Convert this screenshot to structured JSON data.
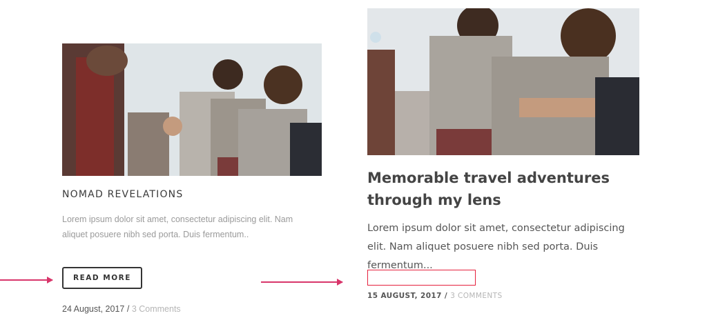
{
  "cards": [
    {
      "title": "NOMAD REVELATIONS",
      "excerpt": "Lorem ipsum dolor sit amet, consectetur adipiscing elit. Nam aliquet posuere nibh sed porta. Duis fermentum..",
      "button_label": "READ MORE",
      "date": "24 August, 2017",
      "separator": "/",
      "comments": "3 Comments"
    },
    {
      "title": "Memorable travel adventures through my lens",
      "excerpt": "Lorem ipsum dolor sit amet, consectetur adipiscing elit. Nam aliquet posuere nibh sed porta. Duis fermentum...",
      "date": "15 AUGUST, 2017",
      "separator": "/",
      "comments": "3 COMMENTS"
    }
  ],
  "colors": {
    "annotation_arrow": "#d8356a",
    "annotation_box": "#e5203c"
  }
}
